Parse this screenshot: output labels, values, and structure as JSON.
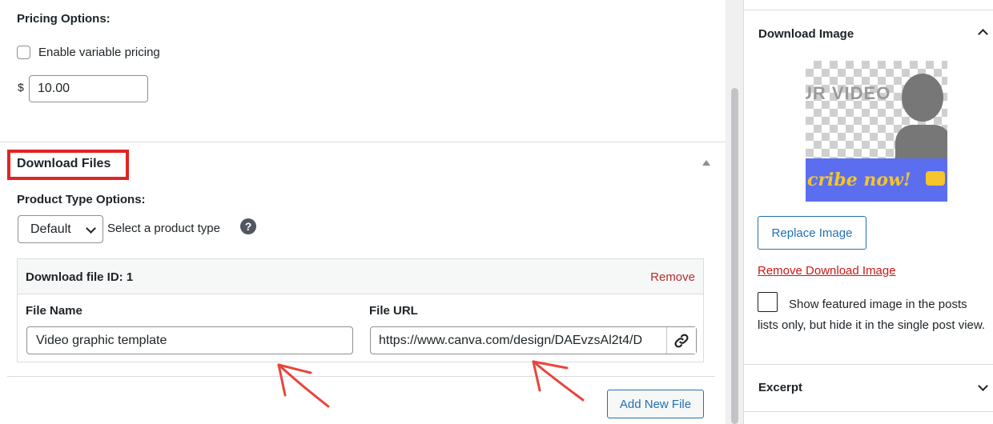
{
  "pricing": {
    "title": "Pricing Options:",
    "variable_label": "Enable variable pricing",
    "currency_symbol": "$",
    "price_value": "10.00"
  },
  "download_files": {
    "title": "Download Files",
    "product_type_title": "Product Type Options:",
    "product_type_selected": "Default",
    "product_type_hint": "Select a product type",
    "help_glyph": "?",
    "file": {
      "id_label": "Download file ID: 1",
      "remove_label": "Remove",
      "name_label": "File Name",
      "url_label": "File URL",
      "name_value": "Video graphic template",
      "url_value": "https://www.canva.com/design/DAEvzsAl2t4/D"
    },
    "add_button": "Add New File"
  },
  "sidebar": {
    "download_image_title": "Download Image",
    "image_text_top": "UR VIDEO",
    "image_text_bottom": "cribe now!",
    "replace_button": "Replace Image",
    "remove_link": "Remove Download Image",
    "featured_option": "Show featured image in the posts lists only, but hide it in the single post view.",
    "excerpt_title": "Excerpt"
  },
  "colors": {
    "accent": "#2271b1",
    "danger": "#b32d2e",
    "highlight_box": "#e02424",
    "annotation_arrow": "#e8453c"
  },
  "icons": [
    "help-icon",
    "link-icon",
    "chevron-up-icon",
    "chevron-down-icon",
    "collapse-triangle-icon"
  ]
}
